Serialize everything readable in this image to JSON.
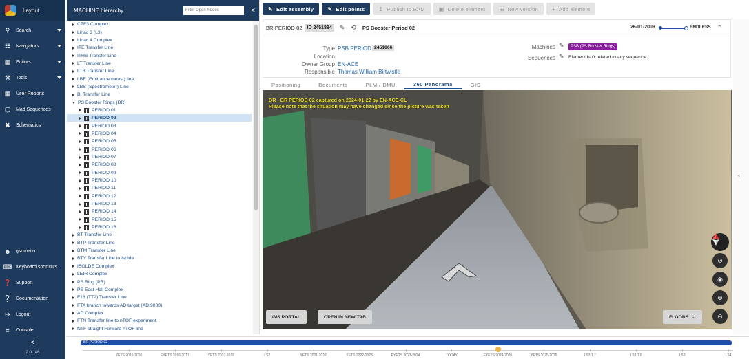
{
  "nav": {
    "brand": "Layout",
    "items": [
      {
        "label": "Search",
        "icon": "search-icon",
        "sub": true
      },
      {
        "label": "Navigators",
        "icon": "sitemap-icon",
        "sub": true
      },
      {
        "label": "Editors",
        "icon": "table-icon",
        "sub": true
      },
      {
        "label": "Tools",
        "icon": "wrench-icon",
        "sub": true
      },
      {
        "label": "User Reports",
        "icon": "report-icon",
        "sub": false
      },
      {
        "label": "Mad Sequences",
        "icon": "file-icon",
        "sub": false
      },
      {
        "label": "Schematics",
        "icon": "tools-cross-icon",
        "sub": false
      }
    ],
    "bottom": [
      {
        "label": "gsumailo",
        "icon": "user-icon"
      },
      {
        "label": "Keyboard shortcuts",
        "icon": "keyboard-icon"
      },
      {
        "label": "Support",
        "icon": "question-icon"
      },
      {
        "label": "Documentation",
        "icon": "help-icon"
      },
      {
        "label": "Logout",
        "icon": "logout-icon"
      },
      {
        "label": "Console",
        "icon": "console-icon"
      }
    ],
    "collapse": "<",
    "version": "2.0.146"
  },
  "tree": {
    "title": "MACHINE hierarchy",
    "filter_placeholder": "Filter Open Nodes",
    "collapse": "<",
    "rows": [
      {
        "label": "CTF3 Complex",
        "level": 0,
        "open": false,
        "building": false
      },
      {
        "label": "Linac 3 (L3)",
        "level": 0,
        "open": false,
        "building": false
      },
      {
        "label": "Linac 4 Complex",
        "level": 0,
        "open": false,
        "building": false
      },
      {
        "label": "ITE Transfer Line",
        "level": 0,
        "open": false,
        "building": false
      },
      {
        "label": "ITHS Transfer Line",
        "level": 0,
        "open": false,
        "building": false
      },
      {
        "label": "LT Transfer Line",
        "level": 0,
        "open": false,
        "building": false
      },
      {
        "label": "LTB Transfer Line",
        "level": 0,
        "open": false,
        "building": false
      },
      {
        "label": "LBE (Emittance meas.) line",
        "level": 0,
        "open": false,
        "building": false
      },
      {
        "label": "LBS (Spectrometer) Line",
        "level": 0,
        "open": false,
        "building": false
      },
      {
        "label": "BI Transfer Line",
        "level": 0,
        "open": false,
        "building": false
      },
      {
        "label": "PS Booster Rings (BR)",
        "level": 0,
        "open": true,
        "building": false
      },
      {
        "label": "PERIOD 01",
        "level": 1,
        "open": false,
        "building": true
      },
      {
        "label": "PERIOD 02",
        "level": 1,
        "open": false,
        "building": true,
        "selected": true
      },
      {
        "label": "PERIOD 03",
        "level": 1,
        "open": false,
        "building": true
      },
      {
        "label": "PERIOD 04",
        "level": 1,
        "open": false,
        "building": true
      },
      {
        "label": "PERIOD 05",
        "level": 1,
        "open": false,
        "building": true
      },
      {
        "label": "PERIOD 06",
        "level": 1,
        "open": false,
        "building": true
      },
      {
        "label": "PERIOD 07",
        "level": 1,
        "open": false,
        "building": true
      },
      {
        "label": "PERIOD 08",
        "level": 1,
        "open": false,
        "building": true
      },
      {
        "label": "PERIOD 09",
        "level": 1,
        "open": false,
        "building": true
      },
      {
        "label": "PERIOD 10",
        "level": 1,
        "open": false,
        "building": true
      },
      {
        "label": "PERIOD 11",
        "level": 1,
        "open": false,
        "building": true
      },
      {
        "label": "PERIOD 12",
        "level": 1,
        "open": false,
        "building": true
      },
      {
        "label": "PERIOD 13",
        "level": 1,
        "open": false,
        "building": true
      },
      {
        "label": "PERIOD 14",
        "level": 1,
        "open": false,
        "building": true
      },
      {
        "label": "PERIOD 15",
        "level": 1,
        "open": false,
        "building": true
      },
      {
        "label": "PERIOD 16",
        "level": 1,
        "open": false,
        "building": true
      },
      {
        "label": "BT Transfer Line",
        "level": 0,
        "open": false,
        "building": false
      },
      {
        "label": "BTP Transfer Line",
        "level": 0,
        "open": false,
        "building": false
      },
      {
        "label": "BTM Transfer Line",
        "level": 0,
        "open": false,
        "building": false
      },
      {
        "label": "BTY Transfer Line to Isolde",
        "level": 0,
        "open": false,
        "building": false
      },
      {
        "label": "ISOLDE Complex",
        "level": 0,
        "open": false,
        "building": false
      },
      {
        "label": "LEIR Complex",
        "level": 0,
        "open": false,
        "building": false
      },
      {
        "label": "PS Ring (PR)",
        "level": 0,
        "open": false,
        "building": false
      },
      {
        "label": "PS East Hall Complex",
        "level": 0,
        "open": false,
        "building": false
      },
      {
        "label": "F16 (TT2) Transfer Line",
        "level": 0,
        "open": false,
        "building": false
      },
      {
        "label": "FTA branch towards AD target (AD.9000)",
        "level": 0,
        "open": false,
        "building": false
      },
      {
        "label": "AD Complex",
        "level": 0,
        "open": false,
        "building": false
      },
      {
        "label": "FTN Transfer line to nTOF experiment",
        "level": 0,
        "open": false,
        "building": false
      },
      {
        "label": "NTF straight Forward nTOF line",
        "level": 0,
        "open": false,
        "building": false
      }
    ]
  },
  "toolbar": [
    {
      "label": "Edit assembly",
      "icon": "pencil-icon",
      "primary": true
    },
    {
      "label": "Edit points",
      "icon": "pencil-icon",
      "primary": true
    },
    {
      "label": "Publish to EAM",
      "icon": "upload-icon",
      "primary": false
    },
    {
      "label": "Delete element",
      "icon": "trash-icon",
      "primary": false
    },
    {
      "label": "New version",
      "icon": "version-icon",
      "primary": false
    },
    {
      "label": "Add element",
      "icon": "plus-icon",
      "primary": false
    }
  ],
  "card": {
    "code": "BR-PERIOD-02",
    "id": "ID 2451884",
    "title": "PS Booster Period 02",
    "date": "26-01-2009",
    "end": "ENDLESS",
    "type_label": "Type",
    "type_value": "PSB PERIOD",
    "type_id": "2451866",
    "location_label": "Location",
    "owner_label": "Owner Group",
    "owner_value": "EN-ACE",
    "responsible_label": "Responsible",
    "responsible_value": "Thomas William Birtwistle",
    "machines_label": "Machines",
    "machines_value": "PSB (PS Booster Rings)",
    "sequences_label": "Sequences",
    "sequences_value": "Element isn't related to any sequence."
  },
  "tabs": [
    {
      "label": "Positioning",
      "active": false
    },
    {
      "label": "Documents",
      "active": false
    },
    {
      "label": "PLM / DMU",
      "active": false
    },
    {
      "label": "360 Panorama",
      "active": true
    },
    {
      "label": "GIS",
      "active": false
    }
  ],
  "pano": {
    "caption1": "BR - BR PERIOD 02 captured on 2024-01-22 by EN-ACE-CL",
    "caption2": "Please note that the situation may have changed since the picture was taken",
    "gis_portal": "GIS PORTAL",
    "open_tab": "OPEN IN NEW TAB",
    "floors": "FLOORS"
  },
  "timeline": {
    "bar_label": "BR-PERIOD-02",
    "labels": [
      "YETS 2015-2016",
      "EYETS 2016-2017",
      "YETS 2017-2018",
      "LS2",
      "YETS 2021-2022",
      "YETS 2022-2023",
      "EYETS 2023-2024",
      "TODAY",
      "EYETS 2024-2025",
      "YETS 2025-2026",
      "LS3 1.7",
      "LS3 1.8",
      "LS3",
      "LS4"
    ]
  },
  "colors": {
    "nav_bg": "#1e3a5c",
    "accent": "#1f4fa8",
    "machine_badge": "#8a1d9e",
    "caption": "#f1e12f",
    "today_marker": "#f2b23a"
  }
}
